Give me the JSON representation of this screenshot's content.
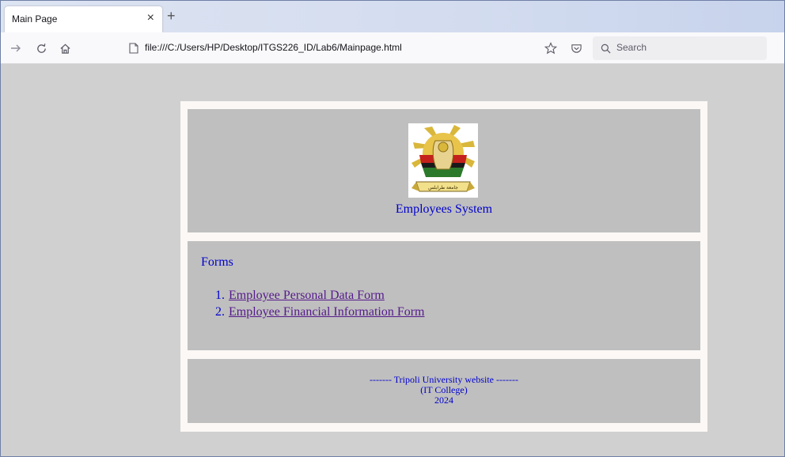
{
  "browser": {
    "tab": {
      "title": "Main Page",
      "close_glyph": "×"
    },
    "new_tab_glyph": "+",
    "url": "file:///C:/Users/HP/Desktop/ITGS226_ID/Lab6/Mainpage.html",
    "search_placeholder": "Search",
    "icons": [
      "forward-icon",
      "reload-icon",
      "home-icon",
      "page-icon",
      "bookmark-star-icon",
      "pocket-icon",
      "search-icon"
    ]
  },
  "page": {
    "header": {
      "logo_caption": "جامعة طرابلس",
      "title": "Employees System"
    },
    "forms": {
      "heading": "Forms",
      "items": [
        {
          "number": "1.",
          "label": "Employee Personal Data Form"
        },
        {
          "number": "2.",
          "label": "Employee Financial Information Form"
        }
      ]
    },
    "footer": {
      "line1": "------- Tripoli University website -------",
      "line2": "(IT College)",
      "line3": "2024"
    }
  },
  "colors": {
    "page_bg": "#d0d0d0",
    "panel_bg": "#bfbfbf",
    "container_bg": "#fbf8f6",
    "text_blue": "#0000cc",
    "link_visited": "#551a8b"
  }
}
